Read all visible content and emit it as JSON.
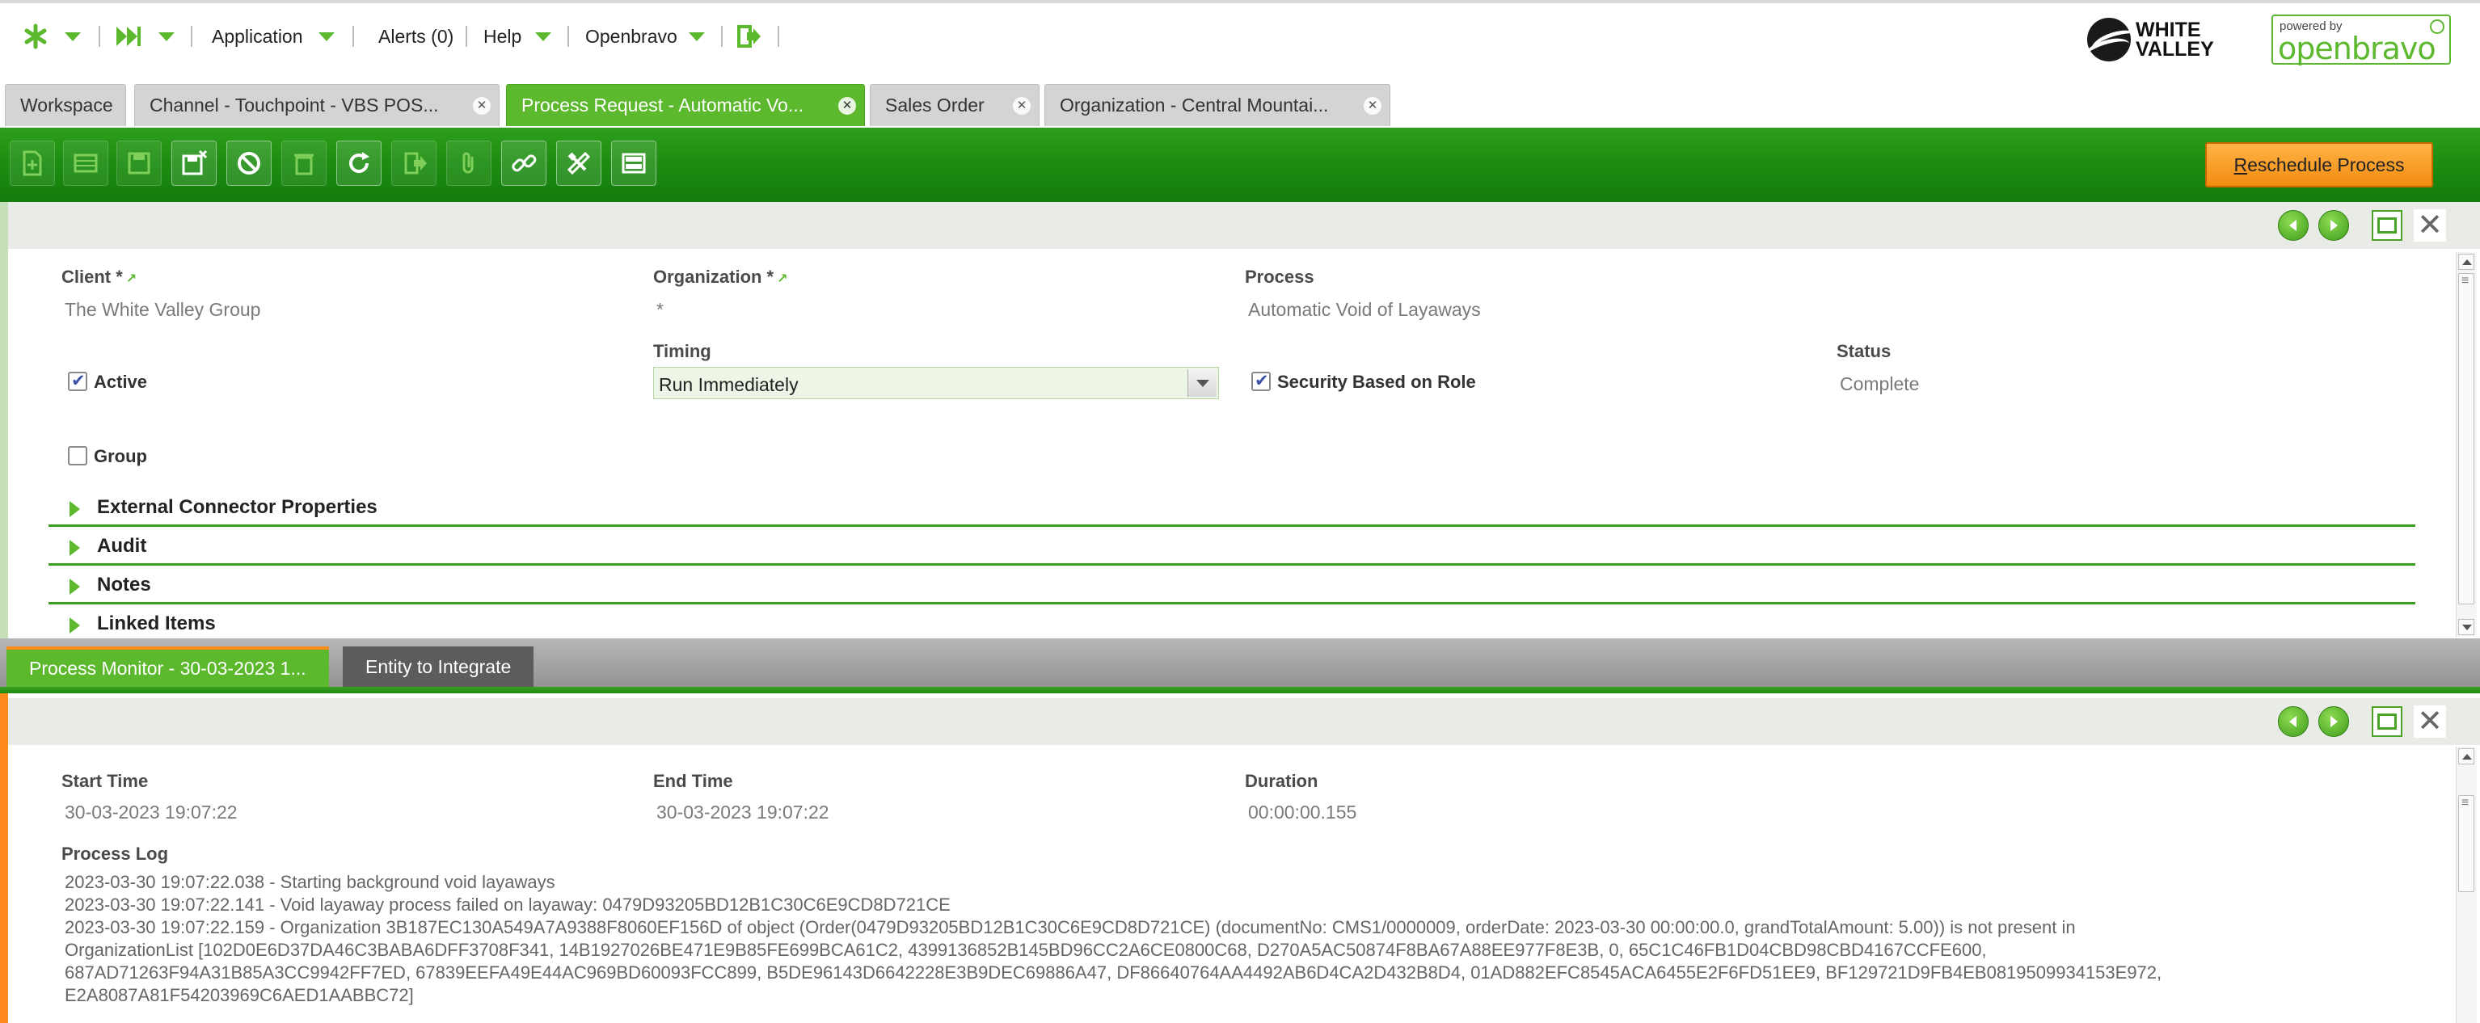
{
  "topnav": {
    "application": "Application",
    "alerts": "Alerts (0)",
    "help": "Help",
    "user": "Openbravo"
  },
  "branding": {
    "left_logo_text_1": "WHITE",
    "left_logo_text_2": "VALLEY",
    "powered_by": "powered by",
    "product": "openbravo"
  },
  "tabs": [
    {
      "label": "Workspace"
    },
    {
      "label": "Channel - Touchpoint - VBS POS..."
    },
    {
      "label": "Process Request - Automatic Vo..."
    },
    {
      "label": "Sales Order"
    },
    {
      "label": "Organization - Central Mountai..."
    }
  ],
  "toolbar": {
    "reschedule_label_first": "R",
    "reschedule_label_rest": "eschedule Process"
  },
  "form": {
    "client_label": "Client *",
    "client_value": "The White Valley Group",
    "org_label": "Organization *",
    "org_value": "*",
    "process_label": "Process",
    "process_value": "Automatic Void of Layaways",
    "active_label": "Active",
    "timing_label": "Timing",
    "timing_value": "Run Immediately",
    "security_label": "Security Based on Role",
    "status_label": "Status",
    "status_value": "Complete",
    "group_label": "Group",
    "sections": [
      "External Connector Properties",
      "Audit",
      "Notes",
      "Linked Items"
    ]
  },
  "subtabs": {
    "active": "Process Monitor - 30-03-2023 1...",
    "inactive": "Entity to Integrate"
  },
  "monitor": {
    "start_label": "Start Time",
    "start_value": "30-03-2023 19:07:22",
    "end_label": "End Time",
    "end_value": "30-03-2023 19:07:22",
    "duration_label": "Duration",
    "duration_value": "00:00:00.155",
    "log_label": "Process Log",
    "log_lines": [
      "2023-03-30 19:07:22.038 - Starting background void layaways",
      "2023-03-30 19:07:22.141 - Void layaway process failed on layaway: 0479D93205BD12B1C30C6E9CD8D721CE",
      "2023-03-30 19:07:22.159 - Organization 3B187EC130A549A7A9388F8060EF156D of object (Order(0479D93205BD12B1C30C6E9CD8D721CE) (documentNo: CMS1/0000009, orderDate: 2023-03-30 00:00:00.0, grandTotalAmount: 5.00)) is not present in",
      "OrganizationList [102D0E6D37DA46C3BABA6DFF3708F341, 14B1927026BE471E9B85FE699BCA61C2, 4399136852B145BD96CC2A6CE0800C68, D270A5AC50874F8BA67A88EE977F8E3B, 0, 65C1C46FB1D04CBD98CBD4167CCFE600,",
      "687AD71263F94A31B85A3CC9942FF7ED, 67839EEFA49E44AC969BD60093FCC899, B5DE96143D6642228E3B9DEC69886A47, DF86640764AA4492AB6D4CA2D432B8D4, 01AD882EFC8545ACA6455E2F6FD51EE9, BF129721D9FB4EB0819509934153E972,",
      "E2A8087A81F54203969C6AED1AABBC72]"
    ]
  }
}
